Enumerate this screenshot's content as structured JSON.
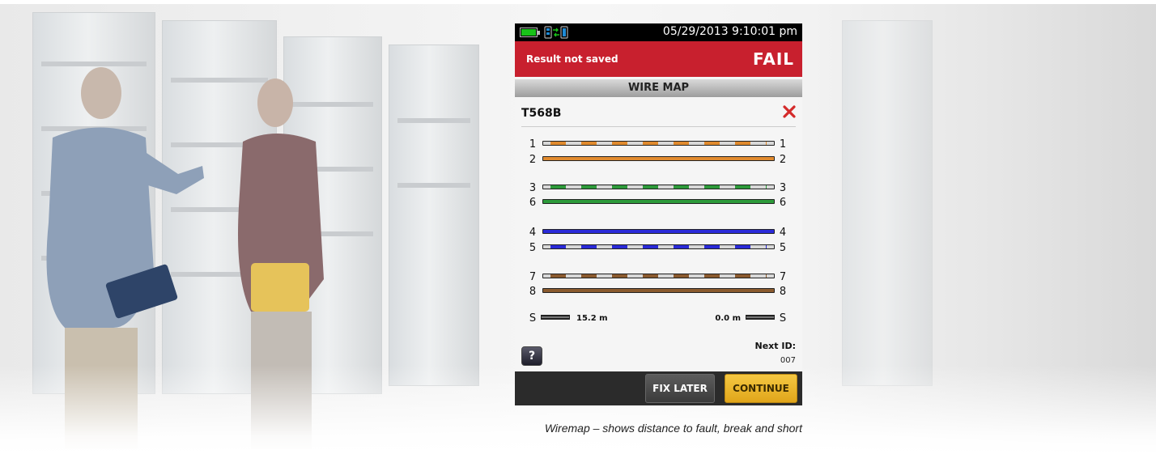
{
  "status_bar": {
    "datetime": "05/29/2013 9:10:01 pm",
    "battery_icon": "battery-full-icon",
    "link_icon": "link-status-icon",
    "battery_color": "#19c219"
  },
  "result": {
    "label": "Result not saved",
    "status": "FAIL",
    "color": "#c8202e"
  },
  "section": {
    "title": "WIRE MAP"
  },
  "standard": {
    "name": "T568B",
    "status_icon": "fail-x-icon"
  },
  "wiremap": {
    "pairs": [
      {
        "near": "1",
        "far": "1",
        "color": "#e08a2e",
        "striped": true
      },
      {
        "near": "2",
        "far": "2",
        "color": "#e08a2e",
        "striped": false
      },
      {
        "near": "3",
        "far": "3",
        "color": "#2d9a3a",
        "striped": true
      },
      {
        "near": "6",
        "far": "6",
        "color": "#2d9a3a",
        "striped": false
      },
      {
        "near": "4",
        "far": "4",
        "color": "#2a2ad8",
        "striped": false
      },
      {
        "near": "5",
        "far": "5",
        "color": "#2a2ad8",
        "striped": true
      },
      {
        "near": "7",
        "far": "7",
        "color": "#8a5a2e",
        "striped": true
      },
      {
        "near": "8",
        "far": "8",
        "color": "#8a5a2e",
        "striped": false
      }
    ],
    "shield": {
      "near": "S",
      "far": "S",
      "near_distance": "15.2 m",
      "far_distance": "0.0 m"
    }
  },
  "help": {
    "label": "?"
  },
  "next_id": {
    "label": "Next ID:",
    "value": "007"
  },
  "footer": {
    "fix_later": "FIX LATER",
    "continue": "CONTINUE"
  },
  "caption": "Wiremap – shows distance to fault, break and short"
}
